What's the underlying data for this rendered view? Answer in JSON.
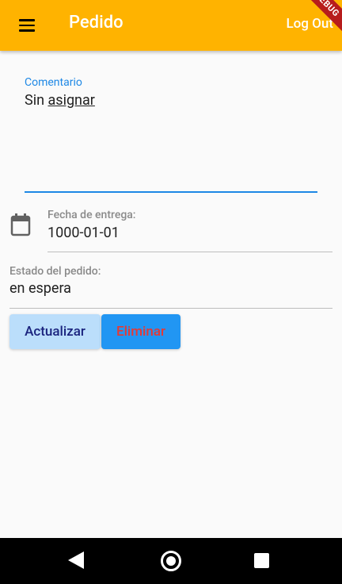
{
  "appbar": {
    "title": "Pedido",
    "logout_label": "Log Out",
    "menu_icon": "menu-icon",
    "debug_banner": "DEBUG"
  },
  "form": {
    "comment": {
      "label": "Comentario",
      "value_word1": "Sin",
      "value_word2": "asignar"
    },
    "date": {
      "icon": "calendar-icon",
      "label": "Fecha de entrega:",
      "value": "1000-01-01"
    },
    "status": {
      "label": "Estado del pedido:",
      "value": "en espera"
    }
  },
  "actions": {
    "update_label": "Actualizar",
    "delete_label": "Eliminar"
  },
  "navbar": {
    "back_icon": "back-icon",
    "home_icon": "home-icon",
    "recent_icon": "recent-apps-icon"
  },
  "colors": {
    "appbar": "#ffb300",
    "accent": "#1e88e5",
    "update_button": "#bbdefb",
    "delete_button": "#2196f3",
    "delete_text": "#e53935"
  }
}
